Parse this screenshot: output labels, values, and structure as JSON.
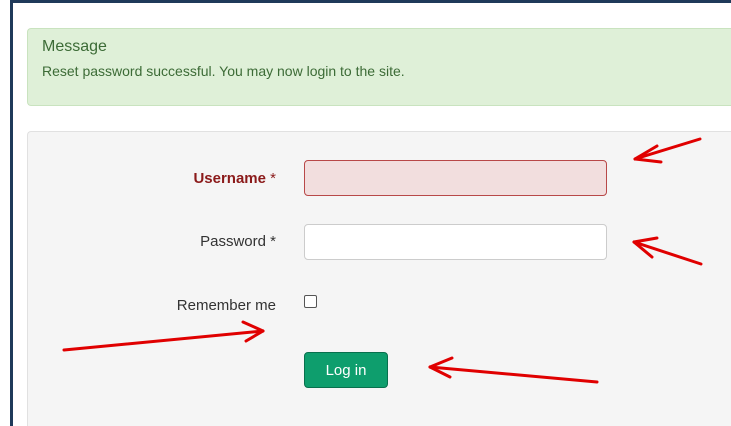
{
  "message": {
    "heading": "Message",
    "text": "Reset password successful. You may now login to the site."
  },
  "form": {
    "username_label": "Username",
    "password_label": "Password",
    "required_mark": "*",
    "remember_label": "Remember me",
    "username_value": "",
    "password_value": "",
    "remember_checked": false,
    "login_button": "Log in"
  },
  "colors": {
    "success_bg": "#dff0d8",
    "invalid_bg": "#f2dede",
    "button_bg": "#0e9e6d",
    "annotation_arrow": "#e00000"
  }
}
